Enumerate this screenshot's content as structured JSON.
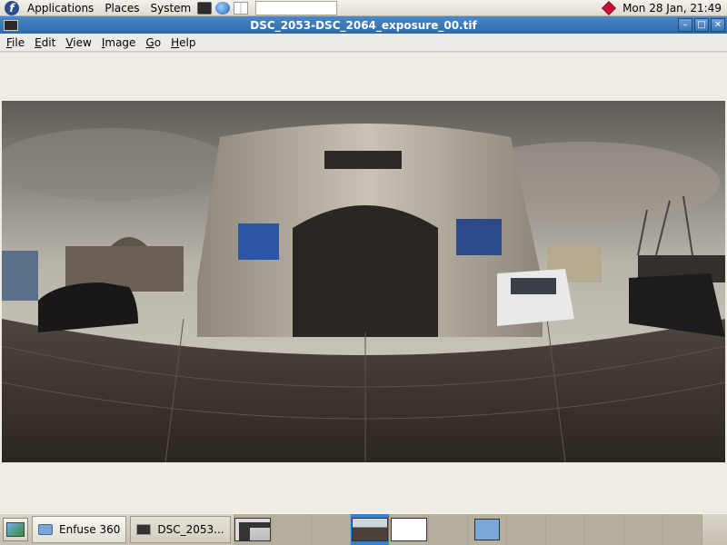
{
  "top_panel": {
    "menus": [
      "Applications",
      "Places",
      "System"
    ],
    "clock": "Mon 28 Jan, 21:49"
  },
  "window": {
    "title": "DSC_2053-DSC_2064_exposure_00.tif",
    "menus": [
      "File",
      "Edit",
      "View",
      "Image",
      "Go",
      "Help"
    ]
  },
  "taskbar": {
    "tasks": [
      "Enfuse 360",
      "DSC_2053..."
    ],
    "workspace_active_index": 5
  },
  "colors": {
    "titlebar": "#3a78bb",
    "panel": "#dcd8cc",
    "active_workspace": "#2f83d8"
  }
}
